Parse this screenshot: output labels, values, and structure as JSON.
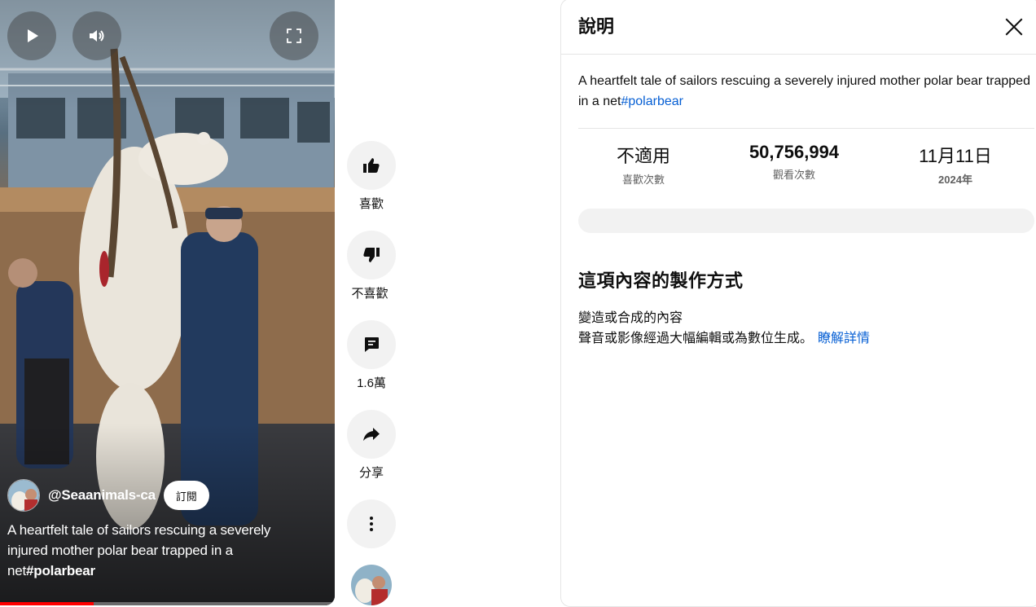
{
  "video": {
    "channel_handle": "@Seaanimals-ca",
    "subscribe_label": "訂閱",
    "caption_text": "A heartfelt tale of sailors rescuing a severely injured mother polar bear trapped in a net",
    "caption_hashtag": "#polarbear",
    "progress_fraction": 0.28,
    "controls": {
      "play_icon": "play-icon",
      "volume_icon": "volume-icon",
      "fullscreen_icon": "fullscreen-icon"
    }
  },
  "actions": {
    "like_label": "喜歡",
    "dislike_label": "不喜歡",
    "comment_count": "1.6萬",
    "share_label": "分享"
  },
  "panel": {
    "title": "說明",
    "description_text": "A heartfelt tale of sailors rescuing a severely injured mother polar bear trapped in a net",
    "description_hashtag": "#polarbear",
    "stats": {
      "likes_value": "不適用",
      "likes_label": "喜歡次數",
      "views_value": "50,756,994",
      "views_label": "觀看次數",
      "date_value": "11月11日",
      "date_year": "2024年"
    },
    "how_made_title": "這項內容的製作方式",
    "altered_label": "變造或合成的內容",
    "altered_desc": "聲音或影像經過大幅編輯或為數位生成。",
    "learn_more": "瞭解詳情"
  },
  "colors": {
    "accent_link": "#065fd4",
    "progress": "#ff0000",
    "action_bg": "#f2f2f2"
  }
}
